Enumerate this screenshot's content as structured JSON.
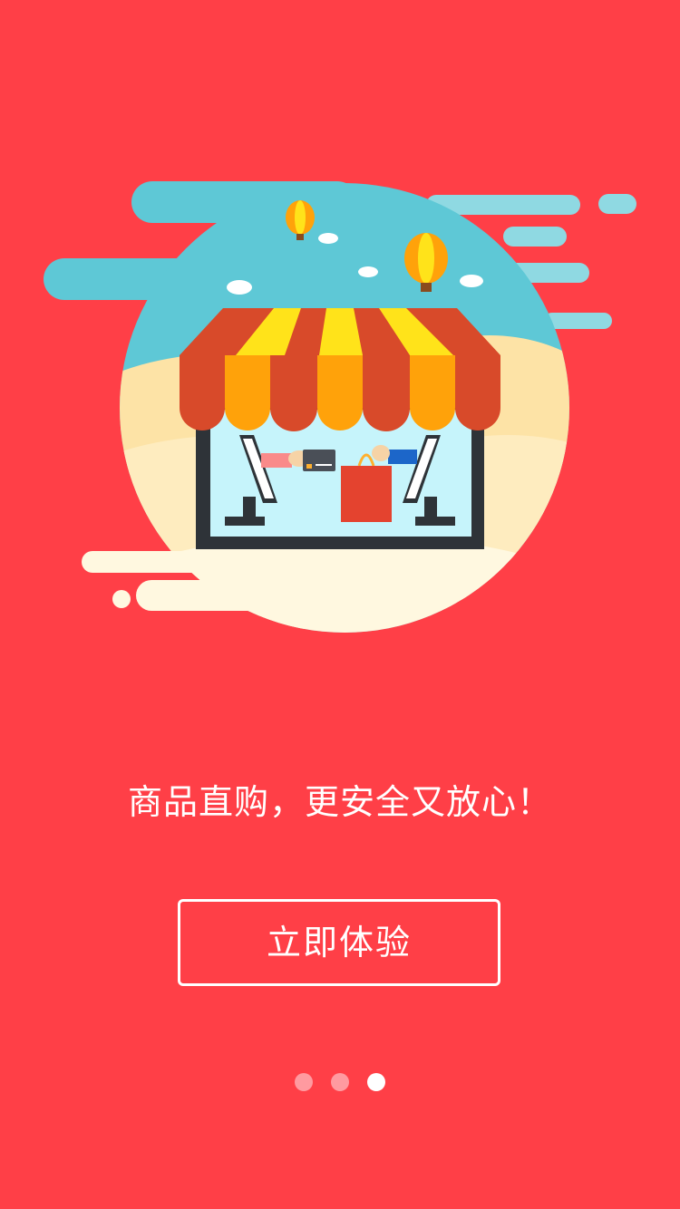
{
  "onboarding": {
    "tagline": "商品直购，更安全又放心！",
    "cta_label": "立即体验",
    "pagination": {
      "total": 3,
      "active_index": 2
    }
  },
  "theme": {
    "background": "#ff3f47",
    "sky": "#5ec8d6",
    "awning_red": "#d84a2a",
    "awning_orange": "#ffa20a",
    "awning_yellow": "#ffe31a",
    "window": "#c6f4fb"
  },
  "illustration": {
    "subject": "storefront-with-awning",
    "icons": [
      "hot-air-balloon-icon",
      "cloud-icon",
      "credit-card-icon",
      "shopping-bag-icon",
      "monitor-icon"
    ]
  }
}
